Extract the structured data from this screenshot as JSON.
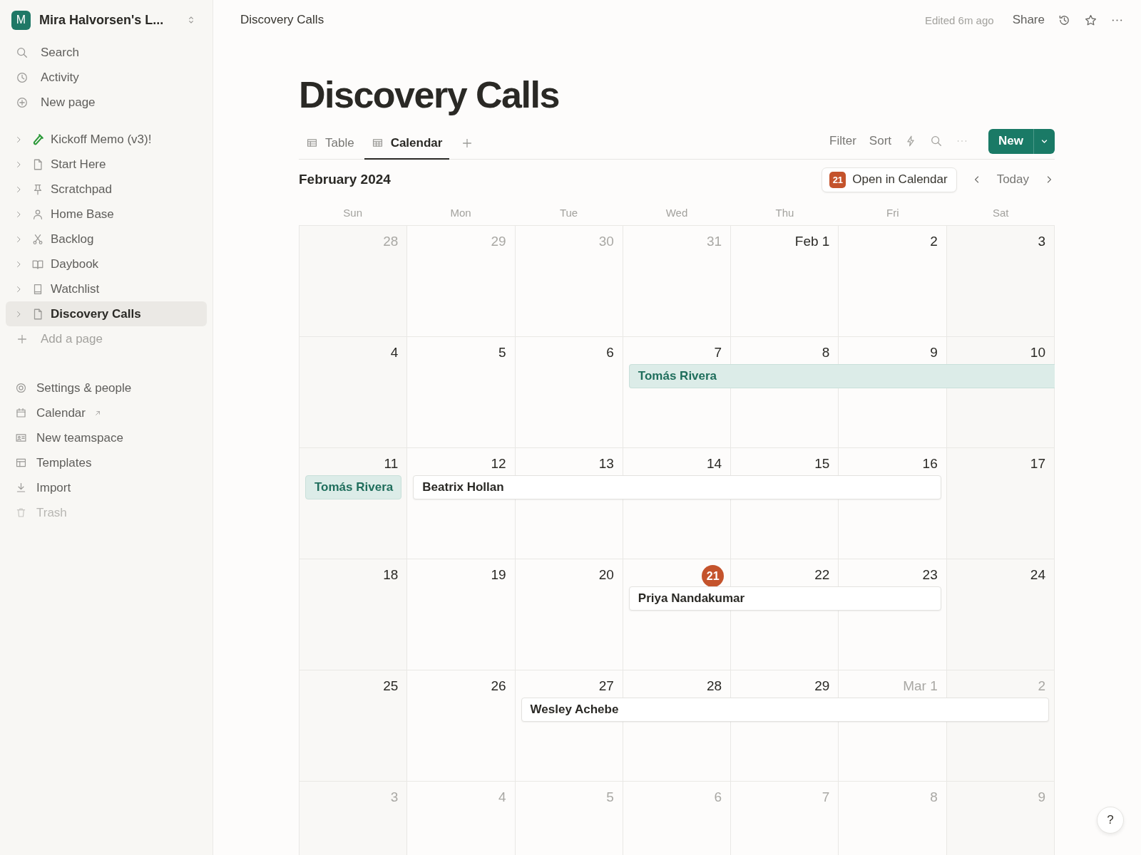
{
  "workspace": {
    "initial": "M",
    "name": "Mira Halvorsen's L..."
  },
  "sidebar": {
    "nav": [
      {
        "label": "Search"
      },
      {
        "label": "Activity"
      },
      {
        "label": "New page"
      }
    ],
    "pages": [
      {
        "label": "Kickoff Memo (v3)!",
        "selected": false
      },
      {
        "label": "Start Here",
        "selected": false
      },
      {
        "label": "Scratchpad",
        "selected": false
      },
      {
        "label": "Home Base",
        "selected": false
      },
      {
        "label": "Backlog",
        "selected": false
      },
      {
        "label": "Daybook",
        "selected": false
      },
      {
        "label": "Watchlist",
        "selected": false
      },
      {
        "label": "Discovery Calls",
        "selected": true
      }
    ],
    "add_page": "Add a page",
    "footer": [
      {
        "label": "Settings & people",
        "external": false,
        "disabled": false
      },
      {
        "label": "Calendar",
        "external": true,
        "disabled": false
      },
      {
        "label": "New teamspace",
        "external": false,
        "disabled": false
      },
      {
        "label": "Templates",
        "external": false,
        "disabled": false
      },
      {
        "label": "Import",
        "external": false,
        "disabled": false
      },
      {
        "label": "Trash",
        "external": false,
        "disabled": true
      }
    ]
  },
  "topbar": {
    "breadcrumb": "Discovery Calls",
    "edited": "Edited 6m ago",
    "share": "Share"
  },
  "page": {
    "title": "Discovery Calls",
    "views": [
      {
        "label": "Table",
        "selected": false
      },
      {
        "label": "Calendar",
        "selected": true
      }
    ],
    "toolbar": {
      "filter": "Filter",
      "sort": "Sort",
      "new": "New"
    }
  },
  "calendar": {
    "month": "February 2024",
    "open_in": {
      "badge": "21",
      "label": "Open in Calendar"
    },
    "today": "Today",
    "weekdays": [
      "Sun",
      "Mon",
      "Tue",
      "Wed",
      "Thu",
      "Fri",
      "Sat"
    ],
    "weeks": [
      {
        "days": [
          {
            "label": "28",
            "in_month": false,
            "today": false,
            "kind": "empty"
          },
          {
            "label": "29",
            "in_month": false,
            "today": false,
            "kind": "empty"
          },
          {
            "label": "30",
            "in_month": false,
            "today": false,
            "kind": "empty"
          },
          {
            "label": "31",
            "in_month": false,
            "today": false,
            "kind": "empty"
          },
          {
            "label": "Feb 1",
            "in_month": true,
            "today": false,
            "kind": "empty"
          },
          {
            "label": "2",
            "in_month": true,
            "today": false,
            "kind": "empty"
          },
          {
            "label": "3",
            "in_month": true,
            "today": false,
            "kind": "empty"
          }
        ]
      },
      {
        "days": [
          {
            "label": "4",
            "in_month": true,
            "today": false,
            "kind": "empty"
          },
          {
            "label": "5",
            "in_month": true,
            "today": false,
            "kind": "empty"
          },
          {
            "label": "6",
            "in_month": true,
            "today": false,
            "kind": "empty"
          },
          {
            "label": "7",
            "in_month": true,
            "today": false,
            "kind": "event_start",
            "event": {
              "title": "Tomás Rivera",
              "kind": "tinted",
              "runs_past_week": true
            }
          },
          {
            "label": "8",
            "in_month": true,
            "today": false,
            "kind": "event_continued"
          },
          {
            "label": "9",
            "in_month": true,
            "today": false,
            "kind": "event_continued"
          },
          {
            "label": "10",
            "in_month": true,
            "today": false,
            "kind": "event_continued"
          }
        ]
      },
      {
        "days": [
          {
            "label": "11",
            "in_month": true,
            "today": false,
            "kind": "event_start",
            "event": {
              "title": "Tomás Rivera",
              "kind": "tinted",
              "runs_past_week": false
            }
          },
          {
            "label": "12",
            "in_month": true,
            "today": false,
            "kind": "event_start",
            "event": {
              "title": "Beatrix Hollan",
              "kind": "plain",
              "runs_past_week": false
            }
          },
          {
            "label": "13",
            "in_month": true,
            "today": false,
            "kind": "event_continued"
          },
          {
            "label": "14",
            "in_month": true,
            "today": false,
            "kind": "event_continued"
          },
          {
            "label": "15",
            "in_month": true,
            "today": false,
            "kind": "event_continued"
          },
          {
            "label": "16",
            "in_month": true,
            "today": false,
            "kind": "event_continued"
          },
          {
            "label": "17",
            "in_month": true,
            "today": false,
            "kind": "empty"
          }
        ]
      },
      {
        "days": [
          {
            "label": "18",
            "in_month": true,
            "today": false,
            "kind": "empty"
          },
          {
            "label": "19",
            "in_month": true,
            "today": false,
            "kind": "empty"
          },
          {
            "label": "20",
            "in_month": true,
            "today": false,
            "kind": "empty"
          },
          {
            "label": "21",
            "in_month": true,
            "today": true,
            "kind": "event_start",
            "event": {
              "title": "Priya Nandakumar",
              "kind": "plain",
              "runs_past_week": false
            }
          },
          {
            "label": "22",
            "in_month": true,
            "today": false,
            "kind": "event_continued"
          },
          {
            "label": "23",
            "in_month": true,
            "today": false,
            "kind": "event_continued"
          },
          {
            "label": "24",
            "in_month": true,
            "today": false,
            "kind": "empty"
          }
        ]
      },
      {
        "days": [
          {
            "label": "25",
            "in_month": true,
            "today": false,
            "kind": "empty"
          },
          {
            "label": "26",
            "in_month": true,
            "today": false,
            "kind": "empty"
          },
          {
            "label": "27",
            "in_month": true,
            "today": false,
            "kind": "event_start",
            "event": {
              "title": "Wesley Achebe",
              "kind": "plain",
              "runs_past_week": false
            }
          },
          {
            "label": "28",
            "in_month": true,
            "today": false,
            "kind": "event_continued"
          },
          {
            "label": "29",
            "in_month": true,
            "today": false,
            "kind": "event_continued"
          },
          {
            "label": "Mar 1",
            "in_month": false,
            "today": false,
            "kind": "event_continued"
          },
          {
            "label": "2",
            "in_month": false,
            "today": false,
            "kind": "event_continued"
          }
        ]
      },
      {
        "days": [
          {
            "label": "3",
            "in_month": false,
            "today": false,
            "kind": "empty"
          },
          {
            "label": "4",
            "in_month": false,
            "today": false,
            "kind": "empty"
          },
          {
            "label": "5",
            "in_month": false,
            "today": false,
            "kind": "empty"
          },
          {
            "label": "6",
            "in_month": false,
            "today": false,
            "kind": "empty"
          },
          {
            "label": "7",
            "in_month": false,
            "today": false,
            "kind": "empty"
          },
          {
            "label": "8",
            "in_month": false,
            "today": false,
            "kind": "empty"
          },
          {
            "label": "9",
            "in_month": false,
            "today": false,
            "kind": "empty"
          }
        ]
      }
    ]
  },
  "help": "?"
}
